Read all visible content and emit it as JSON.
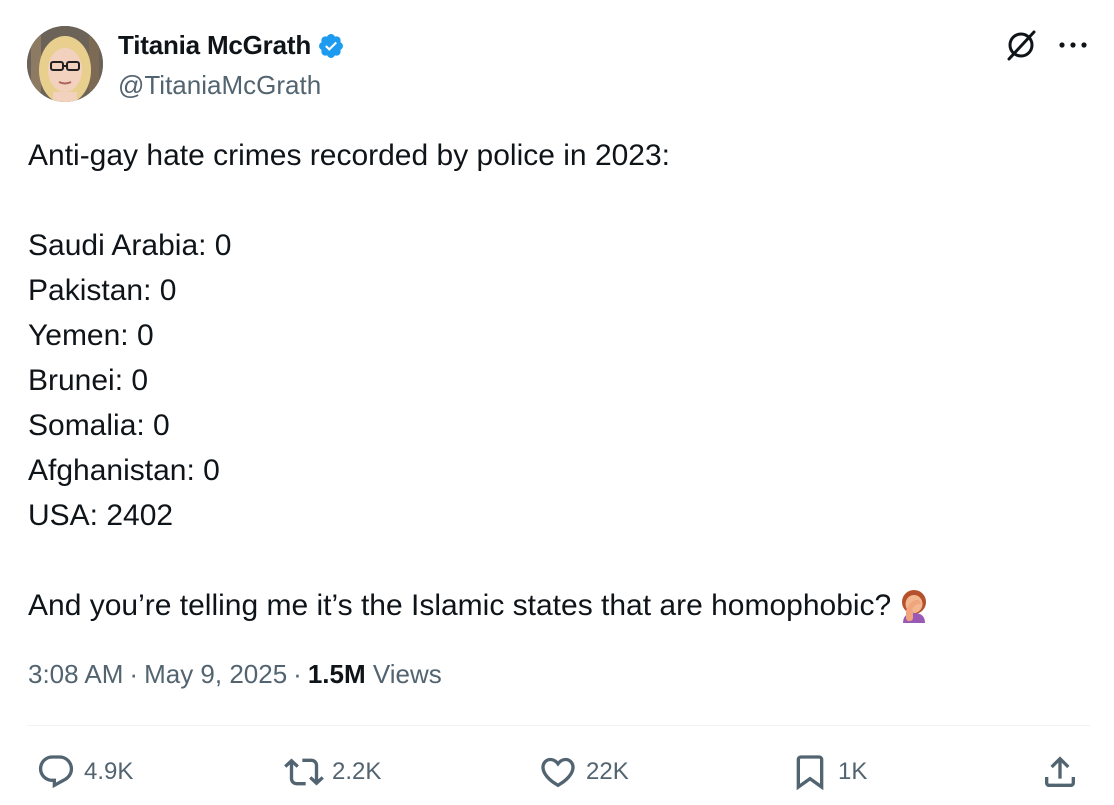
{
  "author": {
    "name": "Titania McGrath",
    "handle": "@TitaniaMcGrath",
    "verified": true,
    "verified_color": "#1d9bf0"
  },
  "icons": {
    "grok": "grok-icon",
    "more": "more-horizontal-icon",
    "emoji": "woman-facepalming-emoji"
  },
  "tweet": {
    "intro": "Anti-gay hate crimes recorded by police in 2023:",
    "lines": [
      "Saudi Arabia: 0",
      "Pakistan: 0",
      "Yemen: 0",
      "Brunei: 0",
      "Somalia: 0",
      "Afghanistan: 0",
      "USA: 2402"
    ],
    "closing": "And you’re telling me it’s the Islamic states that are homophobic?"
  },
  "meta": {
    "time": "3:08 AM",
    "date": "May 9, 2025",
    "views_count": "1.5M",
    "views_label": "Views",
    "separator": "·"
  },
  "actions": {
    "replies": "4.9K",
    "reposts": "2.2K",
    "likes": "22K",
    "bookmarks": "1K"
  },
  "colors": {
    "text": "#0f1419",
    "secondary": "#536471",
    "divider": "#eff3f4"
  }
}
